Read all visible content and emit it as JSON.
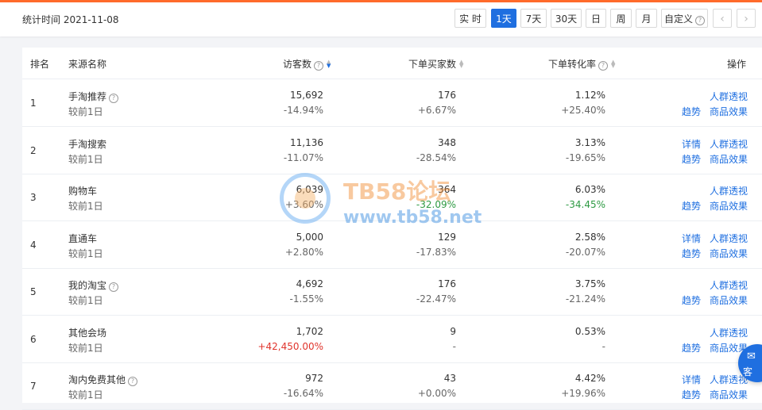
{
  "header": {
    "stat_time": "统计时间 2021-11-08",
    "buttons": [
      "实 时",
      "1天",
      "7天",
      "30天",
      "日",
      "周",
      "月",
      "自定义"
    ],
    "active_button": "1天",
    "prev": "‹",
    "next": "›"
  },
  "table": {
    "columns": [
      "排名",
      "来源名称",
      "访客数",
      "下单买家数",
      "下单转化率",
      "操作"
    ],
    "compare_label": "较前1日",
    "link_detail": "详情",
    "link_trend": "趋势",
    "link_crowd": "人群透视",
    "link_goods": "商品效果",
    "rows": [
      {
        "rank": "1",
        "name": "手淘推荐",
        "help": true,
        "visitors": "15,692",
        "visitors_change": "-14.94%",
        "buyers": "176",
        "buyers_change": "+6.67%",
        "rate": "1.12%",
        "rate_change": "+25.40%",
        "detail": false
      },
      {
        "rank": "2",
        "name": "手淘搜索",
        "help": false,
        "visitors": "11,136",
        "visitors_change": "-11.07%",
        "buyers": "348",
        "buyers_change": "-28.54%",
        "rate": "3.13%",
        "rate_change": "-19.65%",
        "detail": true
      },
      {
        "rank": "3",
        "name": "购物车",
        "help": false,
        "visitors": "6,039",
        "visitors_change": "+3.60%",
        "buyers": "364",
        "buyers_change": "-32.09%",
        "rate": "6.03%",
        "rate_change": "-34.45%",
        "detail": false
      },
      {
        "rank": "4",
        "name": "直通车",
        "help": false,
        "visitors": "5,000",
        "visitors_change": "+2.80%",
        "buyers": "129",
        "buyers_change": "-17.83%",
        "rate": "2.58%",
        "rate_change": "-20.07%",
        "detail": true
      },
      {
        "rank": "5",
        "name": "我的淘宝",
        "help": true,
        "visitors": "4,692",
        "visitors_change": "-1.55%",
        "buyers": "176",
        "buyers_change": "-22.47%",
        "rate": "3.75%",
        "rate_change": "-21.24%",
        "detail": false
      },
      {
        "rank": "6",
        "name": "其他会场",
        "help": false,
        "visitors": "1,702",
        "visitors_change": "+42,450.00%",
        "buyers": "9",
        "buyers_change": "-",
        "rate": "0.53%",
        "rate_change": "-",
        "detail": false
      },
      {
        "rank": "7",
        "name": "淘内免费其他",
        "help": true,
        "visitors": "972",
        "visitors_change": "-16.64%",
        "buyers": "43",
        "buyers_change": "+0.00%",
        "rate": "4.42%",
        "rate_change": "+19.96%",
        "detail": true
      }
    ]
  },
  "watermark": {
    "title": "TB58论坛",
    "url": "www.tb58.net"
  },
  "float_button": {
    "label": "客"
  },
  "colors": {
    "accent": "#1f6fe0",
    "up_red": "#e0342c",
    "down_green": "#2e9a43"
  }
}
